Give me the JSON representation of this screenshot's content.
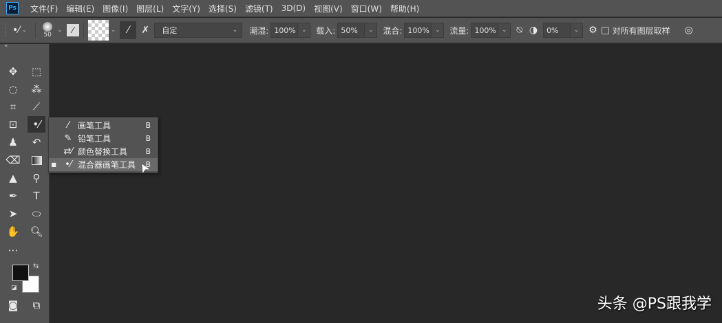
{
  "app": {
    "logo": "Ps"
  },
  "menu": [
    "文件(F)",
    "编辑(E)",
    "图像(I)",
    "图层(L)",
    "文字(Y)",
    "选择(S)",
    "滤镜(T)",
    "3D(D)",
    "视图(V)",
    "窗口(W)",
    "帮助(H)"
  ],
  "options": {
    "brush_size": "50",
    "preset": "自定",
    "wet_label": "潮湿:",
    "wet_value": "100%",
    "load_label": "载入:",
    "load_value": "50%",
    "mix_label": "混合:",
    "mix_value": "100%",
    "flow_label": "流量:",
    "flow_value": "100%",
    "angle_value": "0%",
    "sample_all_label": "对所有图层取样",
    "sample_all_checked": false
  },
  "flyout": {
    "items": [
      {
        "label": "画笔工具",
        "key": "B",
        "icon": "brush-icon",
        "selected": false
      },
      {
        "label": "铅笔工具",
        "key": "B",
        "icon": "pencil-icon",
        "selected": false
      },
      {
        "label": "颜色替换工具",
        "key": "B",
        "icon": "color-replace-icon",
        "selected": false
      },
      {
        "label": "混合器画笔工具",
        "key": "B",
        "icon": "mixer-brush-icon",
        "selected": true
      }
    ]
  },
  "watermark": "头条 @PS跟我学"
}
